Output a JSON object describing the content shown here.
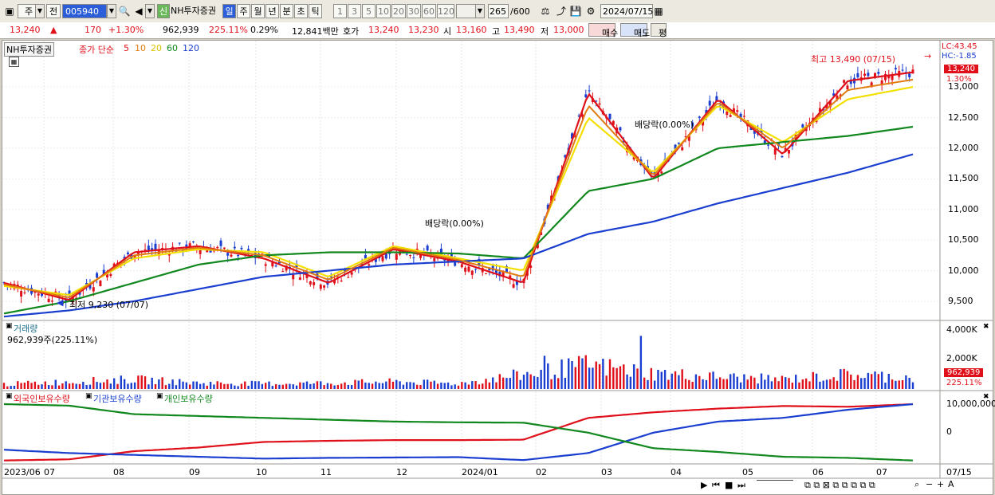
{
  "toolbar": {
    "market_label": "주",
    "type_label": "전",
    "code_value": "005940",
    "sin_badge": "신",
    "stock_name": "NH투자증권",
    "period_tabs": [
      "일",
      "주",
      "월",
      "년",
      "분",
      "초",
      "틱"
    ],
    "active_period": "일",
    "minute_options": [
      "1",
      "3",
      "5",
      "10",
      "20",
      "30",
      "60",
      "120"
    ],
    "count_value": "265",
    "count_max": "/600",
    "date_value": "2024/07/15"
  },
  "quote": {
    "price": "13,240",
    "change_arrow": "▲",
    "change": "170",
    "change_pct": "+1.30%",
    "volume": "962,939",
    "volume_ratio": "225.11%",
    "turnover_rate": "0.29%",
    "trade_value": "12,841백만",
    "ask_label": "호가",
    "ask": "13,240",
    "bid": "13,230",
    "open_label": "시",
    "open": "13,160",
    "high_label": "고",
    "high": "13,490",
    "low_label": "저",
    "low": "13,000",
    "buy_button": "매수",
    "sell_button": "매도",
    "eval_button": "평"
  },
  "price_panel": {
    "stock_name": "NH투자증권",
    "ma_label": "종가 단순",
    "ma_periods": [
      "5",
      "10",
      "20",
      "60",
      "120"
    ],
    "ma_colors": [
      "#e0101a",
      "#e07c10",
      "#f3e000",
      "#11881e",
      "#1a3fd0"
    ],
    "lc_label": "LC:43.45",
    "hc_label": "HC:-1.85",
    "current_price_tag": "13,240",
    "current_pct_tag": "1.30%",
    "high_annotation": "최고 13,490 (07/15)",
    "low_annotation": "최저 9,230 (07/07)",
    "dividend_annotation_1": "배당락(0.00%)",
    "dividend_annotation_2": "배당락(0.00%)",
    "y_ticks": [
      "13,000",
      "12,500",
      "12,000",
      "11,500",
      "11,000",
      "10,500",
      "10,000",
      "9,500"
    ]
  },
  "volume_panel": {
    "title": "거래량",
    "value_label": "962,939주(225.11%)",
    "y_ticks": [
      "4,000K",
      "2,000K"
    ],
    "current_tag": "962,939",
    "current_pct_tag": "225.11%"
  },
  "holding_panel": {
    "legend": [
      "외국인보유수량",
      "기관보유수량",
      "개인보유수량"
    ],
    "legend_colors": [
      "#e0101a",
      "#1a3fd0",
      "#11881e"
    ],
    "y_ticks": [
      "10,000,000",
      "0"
    ]
  },
  "x_axis": {
    "labels": [
      "2023/06",
      "07",
      "08",
      "09",
      "10",
      "11",
      "12",
      "2024/01",
      "02",
      "03",
      "04",
      "05",
      "06",
      "07"
    ],
    "right_label": "07/15"
  },
  "chart_data": [
    {
      "type": "line",
      "title": "NH투자증권",
      "ylim": [
        9200,
        13600
      ],
      "ylabel": "",
      "x": [
        "2023/06",
        "07",
        "08",
        "09",
        "10",
        "11",
        "12",
        "2024/01",
        "02",
        "03",
        "04",
        "05",
        "06",
        "07"
      ],
      "series": [
        {
          "name": "5",
          "values": [
            9800,
            9520,
            10300,
            10400,
            10200,
            9800,
            10350,
            10150,
            9800,
            12900,
            11500,
            12800,
            11900,
            13100,
            13240
          ]
        },
        {
          "name": "20",
          "values": [
            9750,
            9600,
            10200,
            10350,
            10300,
            9900,
            10400,
            10200,
            10000,
            12500,
            11600,
            12700,
            12100,
            12800,
            13000
          ]
        },
        {
          "name": "60",
          "values": [
            9300,
            9500,
            9800,
            10100,
            10250,
            10300,
            10300,
            10280,
            10200,
            11300,
            11500,
            12000,
            12100,
            12200,
            12350
          ]
        },
        {
          "name": "120",
          "values": [
            9250,
            9350,
            9500,
            9700,
            9900,
            10000,
            10100,
            10150,
            10200,
            10600,
            10800,
            11100,
            11350,
            11600,
            11900
          ]
        }
      ],
      "annotations": {
        "high": 13490,
        "high_date": "07/15",
        "low": 9230,
        "low_date": "07/07"
      }
    },
    {
      "type": "bar",
      "title": "거래량",
      "ylim": [
        0,
        4500000
      ],
      "x": [
        "2023/06",
        "07",
        "08",
        "09",
        "10",
        "11",
        "12",
        "2024/01",
        "02",
        "03",
        "04",
        "05",
        "06",
        "07"
      ],
      "values": [
        400000,
        600000,
        800000,
        500000,
        450000,
        500000,
        600000,
        450000,
        1200000,
        2000000,
        1300000,
        1000000,
        800000,
        1200000,
        962939
      ]
    },
    {
      "type": "line",
      "ylim": [
        -5000000,
        12000000
      ],
      "x": [
        "2023/06",
        "07",
        "08",
        "09",
        "10",
        "11",
        "12",
        "2024/01",
        "02",
        "03",
        "04",
        "05",
        "06",
        "07"
      ],
      "series": [
        {
          "name": "외국인보유수량",
          "values": [
            -4500000,
            -4200000,
            -2000000,
            -1000000,
            500000,
            800000,
            1000000,
            1000000,
            1100000,
            7000000,
            8500000,
            9500000,
            10200000,
            10000000,
            10700000
          ]
        },
        {
          "name": "기관보유수량",
          "values": [
            -1600000,
            -2500000,
            -3000000,
            -3500000,
            -4000000,
            -3800000,
            -3700000,
            -3600000,
            -4400000,
            -2500000,
            3000000,
            6000000,
            7000000,
            9200000,
            10700000
          ]
        },
        {
          "name": "개인보유수량",
          "values": [
            10700000,
            10300000,
            8000000,
            7500000,
            7000000,
            6500000,
            6000000,
            5800000,
            5700000,
            3000000,
            -1200000,
            -2200000,
            -3500000,
            -3800000,
            -4500000
          ]
        }
      ]
    }
  ]
}
